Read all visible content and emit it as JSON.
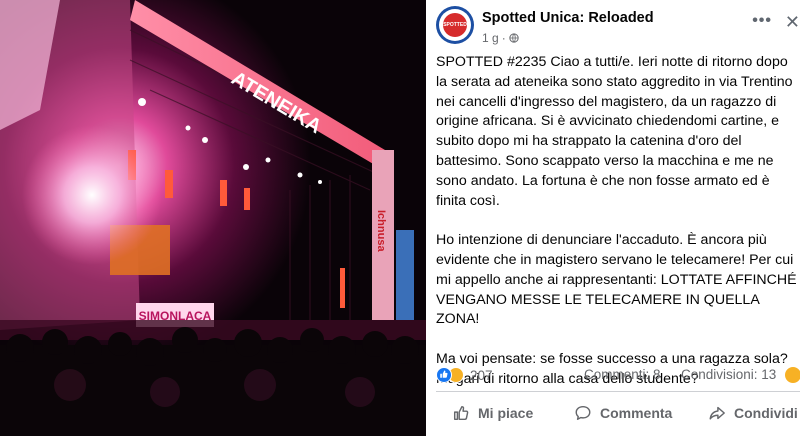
{
  "post": {
    "page_name": "Spotted Unica: Reloaded",
    "avatar_text": "SPOTTED",
    "time": "1 g",
    "more_label": "•••",
    "close_label": "✕",
    "paragraphs": [
      "SPOTTED #2235 Ciao a tutti/e. Ieri notte di ritorno dopo\nla serata ad ateneika sono stato aggredito in via Trentino\nnei cancelli d'ingresso del magistero, da un ragazzo di\norigine africana. Si è avvicinato chiedendomi cartine, e\nsubito dopo mi ha strappato la catenina d'oro del\nbattesimo. Sono scappato verso la macchina e me ne\nsono andato. La fortuna è che non fosse armato ed è\nfinita così.",
      "Ho intenzione di denunciare l'accaduto. È ancora più\nevidente che in magistero servano le telecamere! Per cui\nmi appello anche ai rappresentanti: LOTTATE AFFINCHÉ\nVENGANO MESSE LE TELECAMERE IN QUELLA ZONA!",
      "Ma voi pensate: se fosse successo a una ragazza sola?\nMagari di ritorno alla casa dello studente?"
    ],
    "reaction_count": "207",
    "comments": "Commenti: 8",
    "shares": "Condivisioni: 13",
    "actions": {
      "like": "Mi piace",
      "comment": "Commenta",
      "share": "Condividi"
    },
    "icons": [
      "globe-icon",
      "like-icon",
      "comment-icon",
      "share-icon"
    ],
    "colors": {
      "like_blue": "#1877f2",
      "sad_yellow": "#f7b125",
      "muted": "#65676b"
    }
  },
  "photo": {
    "stage_banner": "ATENEIKA",
    "screen_text": "SIMONLACA",
    "side_banner": "Ichnusa"
  }
}
